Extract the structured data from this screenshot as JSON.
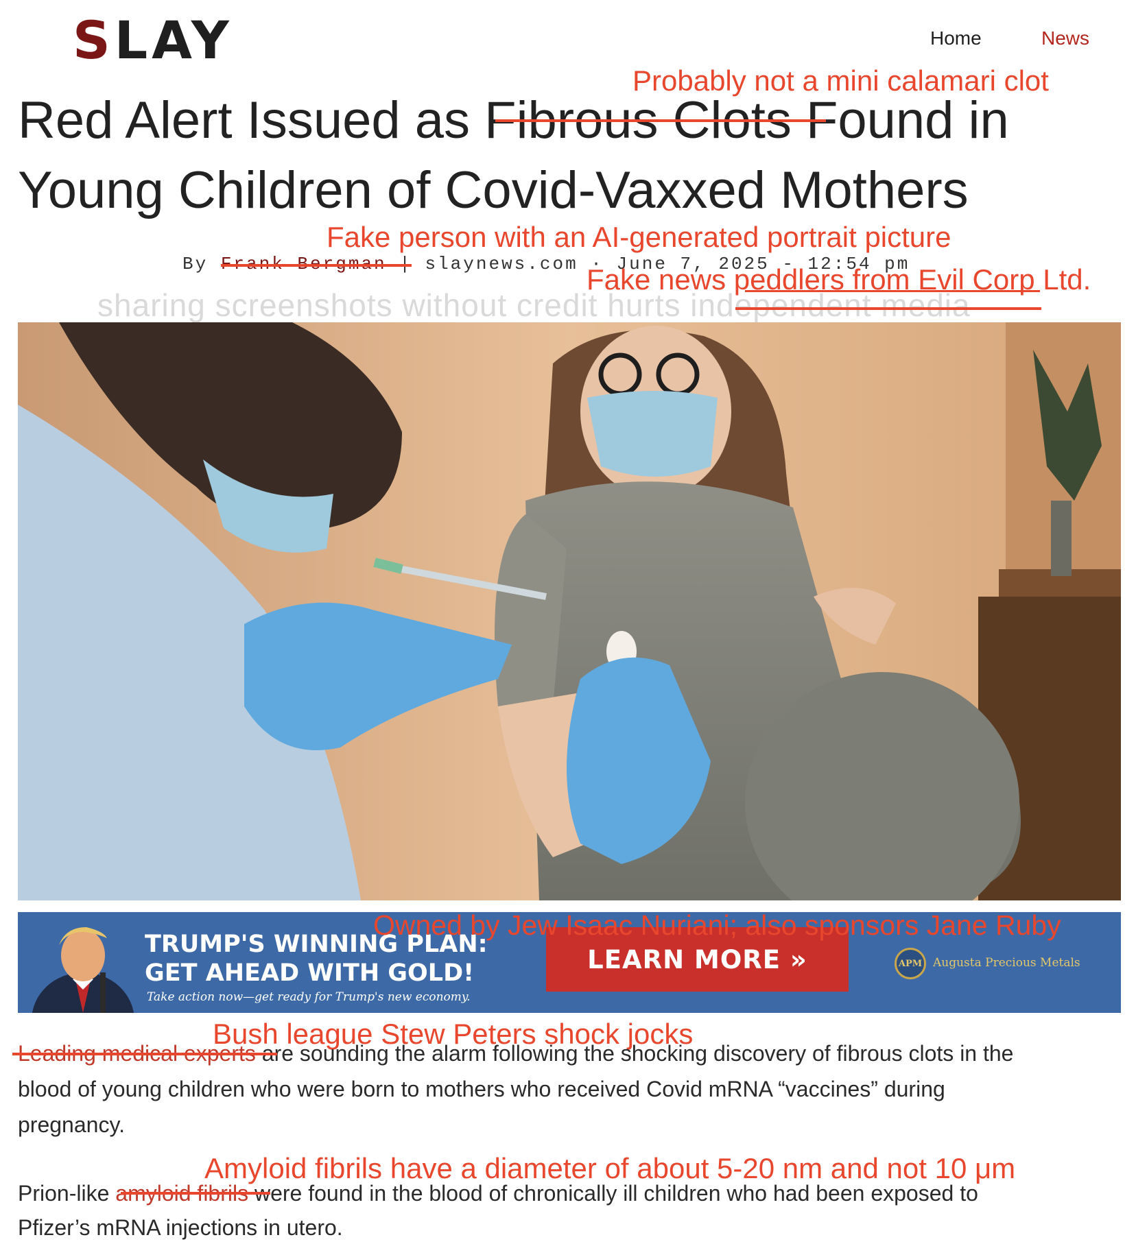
{
  "header": {
    "logo_first": "S",
    "logo_rest": "LAY",
    "nav": [
      "Home",
      "News"
    ]
  },
  "headline": {
    "line1_a": "Red Alert Issued as ",
    "line1_struck": "Fibrous Clots",
    "line1_b": " Found in",
    "line2": "Young Children of Covid-Vaxxed Mothers"
  },
  "byline": {
    "prefix": "By ",
    "author": "Frank Bergman",
    "source": " | slaynews.com",
    "sep": " · ",
    "date": "June 7, 2025 - 12:54 pm"
  },
  "watermark": {
    "text": "sharing screenshots without credit hurts ",
    "struck": "independent media"
  },
  "annotations": {
    "calamari": "Probably not a mini calamari clot",
    "fake_person": "Fake person with an AI-generated portrait picture",
    "peddlers": "Fake news peddlers from Evil Corp Ltd.",
    "owned": "Owned by Jew Isaac Nuriani; also sponsors Jane Ruby",
    "bush_league": "Bush league Stew Peters shock jocks",
    "amyloid": "Amyloid fibrils have a diameter of about 5-20 nm and not 10 μm"
  },
  "ad": {
    "line1": "TRUMP'S WINNING PLAN:",
    "line2": "GET AHEAD WITH GOLD!",
    "tagline": "Take action now—get ready for Trump's new economy.",
    "button": "LEARN MORE »",
    "seal": "APM",
    "brand": "Augusta Precious Metals"
  },
  "article": {
    "p1_struck": "Leading medical experts",
    "p1_line1": " are sounding the alarm following the shocking discovery of fibrous clots in the",
    "p1_line2": "blood of young children who were born to mothers who received Covid mRNA “vaccines” during",
    "p1_line3": "pregnancy.",
    "p2_a": "Prion-like ",
    "p2_struck": "amyloid fibrils",
    "p2_b": " were found in the blood of chronically ill children who had been exposed to",
    "p2_line2": "Pfizer’s mRNA injections in utero."
  },
  "colors": {
    "annotation": "#e8472e",
    "logo_accent": "#7a1616",
    "ad_blue": "#3d6aa6",
    "ad_button": "#c9302b"
  }
}
